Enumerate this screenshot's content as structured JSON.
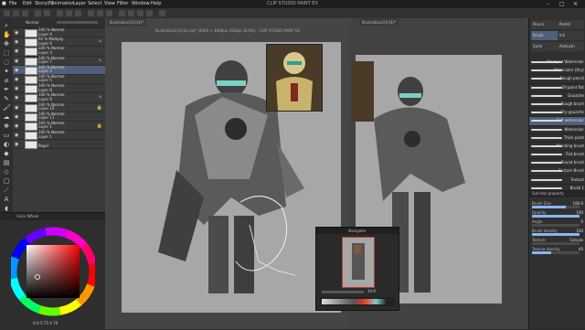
{
  "app": {
    "title": "CLIP STUDIO PAINT EX"
  },
  "menu": [
    "File",
    "Edit",
    "Story(P)",
    "Animation",
    "Layer",
    "Select",
    "View",
    "Filter",
    "Window",
    "Help"
  ],
  "layers": {
    "tab": "Normal",
    "items": [
      {
        "name": "Layer 4",
        "mode": "100 % Normal",
        "flag": ""
      },
      {
        "name": "Layer 6",
        "mode": "92 % Multiply",
        "flag": "✎"
      },
      {
        "name": "Layer 3",
        "mode": "100 % Normal",
        "flag": ""
      },
      {
        "name": "Layer 7",
        "mode": "100 % Normal",
        "flag": "✎"
      },
      {
        "name": "Layer 2",
        "mode": "100 % Normal",
        "flag": ""
      },
      {
        "name": "Layer 5",
        "mode": "100 % Normal",
        "flag": ""
      },
      {
        "name": "Layer 8",
        "mode": "100 % Normal",
        "flag": ""
      },
      {
        "name": "Layer 9",
        "mode": "100 % Normal",
        "flag": "✎"
      },
      {
        "name": "Layer 10",
        "mode": "100 % Normal",
        "flag": "🔒"
      },
      {
        "name": "Layer 11",
        "mode": "100 % Normal",
        "flag": ""
      },
      {
        "name": "Layer 1",
        "mode": "100 % Normal",
        "flag": "🔒"
      },
      {
        "name": "Layer 1",
        "mode": "100 % Normal",
        "flag": ""
      },
      {
        "name": "Paper",
        "mode": "",
        "flag": ""
      }
    ]
  },
  "color_panel": {
    "title": "Color Wheel",
    "readout": "H 0   S 75   V 70"
  },
  "documents": [
    {
      "tab": "Illustration2(1)(4)*"
    },
    {
      "tab": "Illustration2(1)(4)*"
    }
  ],
  "canvas_title": "Illustration2(1)(4).clip* (2000 × 4096px 350dpi 34.9%) - CLIP STUDIO PAINT EX",
  "navigator": {
    "title": "Navigator",
    "zoom": "34.9"
  },
  "right_panel": {
    "tools": [
      "Pencil",
      "Pastel",
      "Brush",
      "Ink",
      "Sumi",
      "Airbrush"
    ],
    "brushes": [
      "Stamped Watercolor",
      "Watercolor (Dry)",
      "Rough pencil",
      "Oil paint flat",
      "Gouache",
      "Rough brush",
      "Dry gouache",
      "Soft watercolor",
      "Watercolor",
      "Thick paint",
      "Blending brush",
      "Flat brush",
      "Round brush",
      "Custom Brush",
      "Texture",
      "Brush 1"
    ],
    "props_title": "Sub tool property",
    "props": [
      {
        "label": "Brush Size",
        "value": "180.0",
        "level": 0.72
      },
      {
        "label": "Opacity",
        "value": "100",
        "level": 1.0
      },
      {
        "label": "Angle",
        "value": "0",
        "level": 0.0
      },
      {
        "label": "Brush density",
        "value": "100",
        "level": 1.0
      },
      {
        "label": "Texture",
        "value": "Canvas",
        "level": 0.0
      },
      {
        "label": "Texture density",
        "value": "40",
        "level": 0.4
      }
    ]
  },
  "colors": {
    "accent": "#50607a",
    "swatch_red": "#c0392b"
  }
}
